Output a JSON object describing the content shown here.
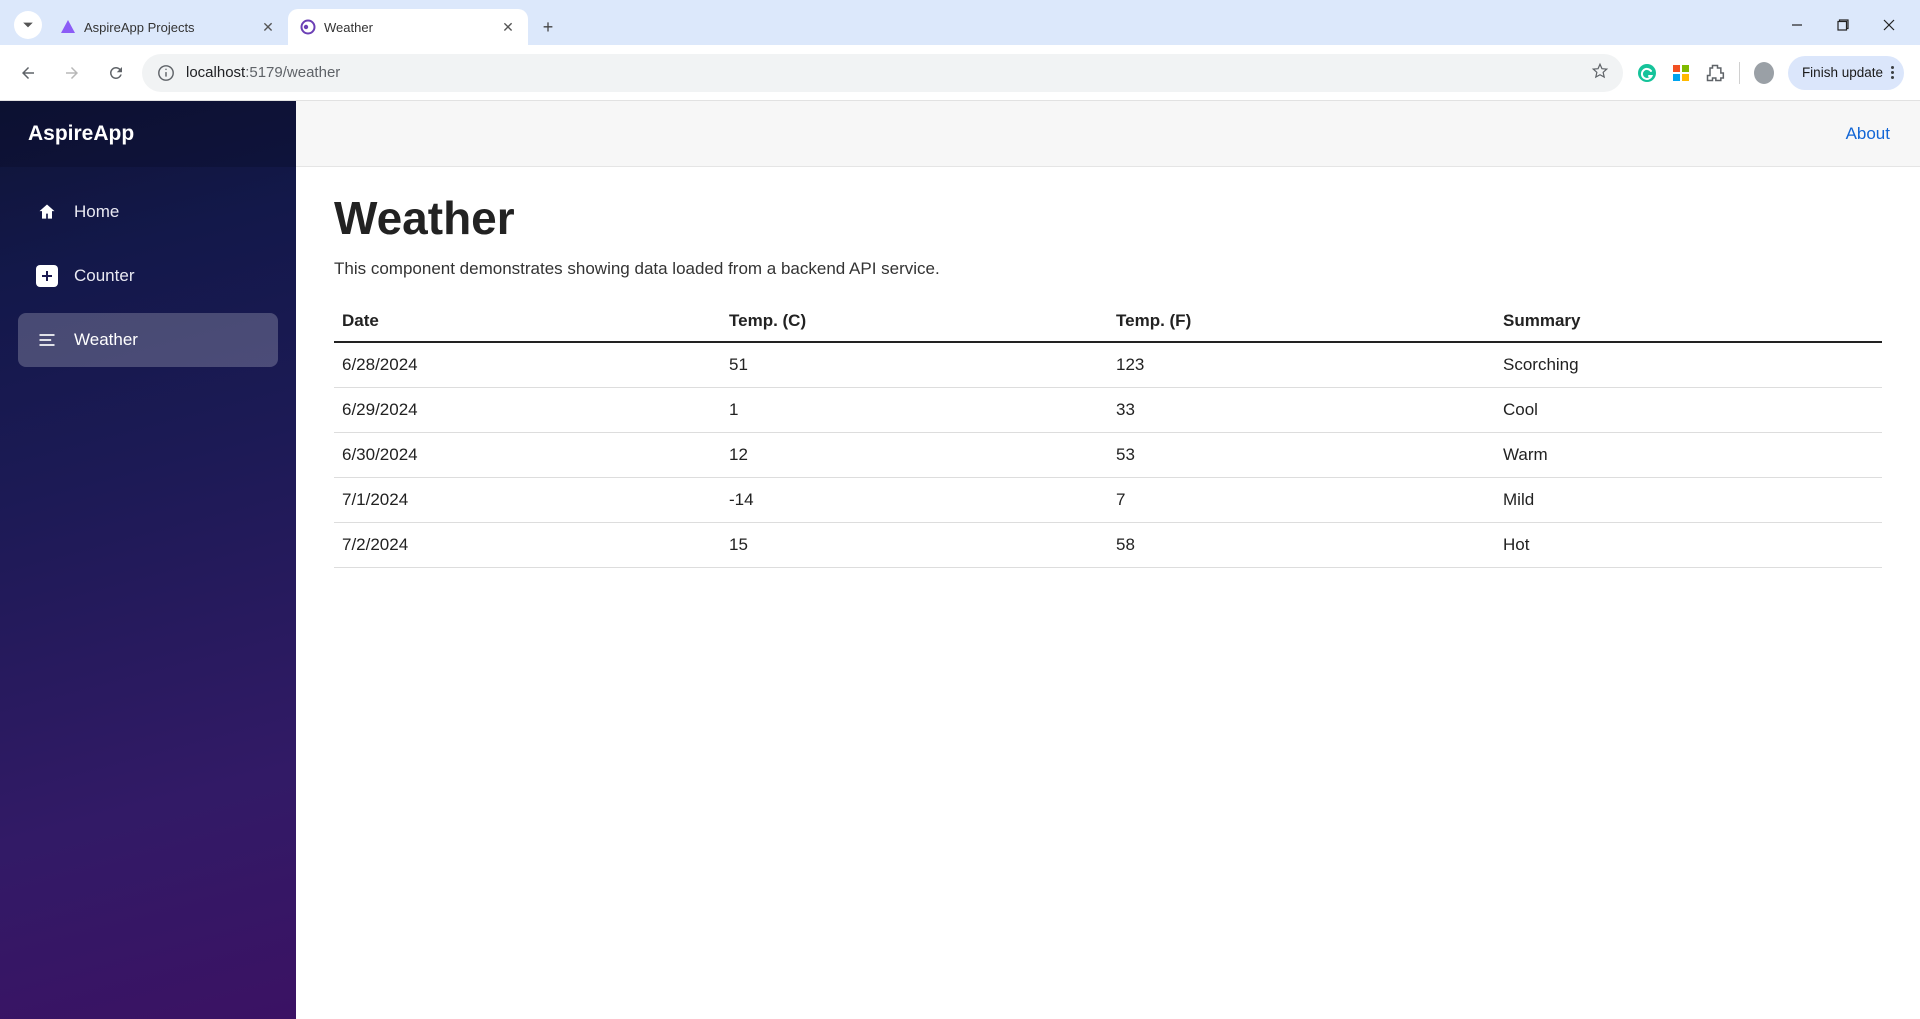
{
  "browser": {
    "tabs": [
      {
        "title": "AspireApp Projects",
        "active": false
      },
      {
        "title": "Weather",
        "active": true
      }
    ],
    "url_host": "localhost",
    "url_port": ":5179",
    "url_path": "/weather",
    "update_label": "Finish update"
  },
  "sidebar": {
    "brand": "AspireApp",
    "items": [
      {
        "label": "Home",
        "icon": "home",
        "active": false
      },
      {
        "label": "Counter",
        "icon": "plus-box",
        "active": false
      },
      {
        "label": "Weather",
        "icon": "lines",
        "active": true
      }
    ]
  },
  "topbar": {
    "about_label": "About"
  },
  "page": {
    "title": "Weather",
    "lead": "This component demonstrates showing data loaded from a backend API service."
  },
  "table": {
    "headers": [
      "Date",
      "Temp. (C)",
      "Temp. (F)",
      "Summary"
    ],
    "rows": [
      {
        "date": "6/28/2024",
        "c": "51",
        "f": "123",
        "summary": "Scorching"
      },
      {
        "date": "6/29/2024",
        "c": "1",
        "f": "33",
        "summary": "Cool"
      },
      {
        "date": "6/30/2024",
        "c": "12",
        "f": "53",
        "summary": "Warm"
      },
      {
        "date": "7/1/2024",
        "c": "-14",
        "f": "7",
        "summary": "Mild"
      },
      {
        "date": "7/2/2024",
        "c": "15",
        "f": "58",
        "summary": "Hot"
      }
    ]
  }
}
